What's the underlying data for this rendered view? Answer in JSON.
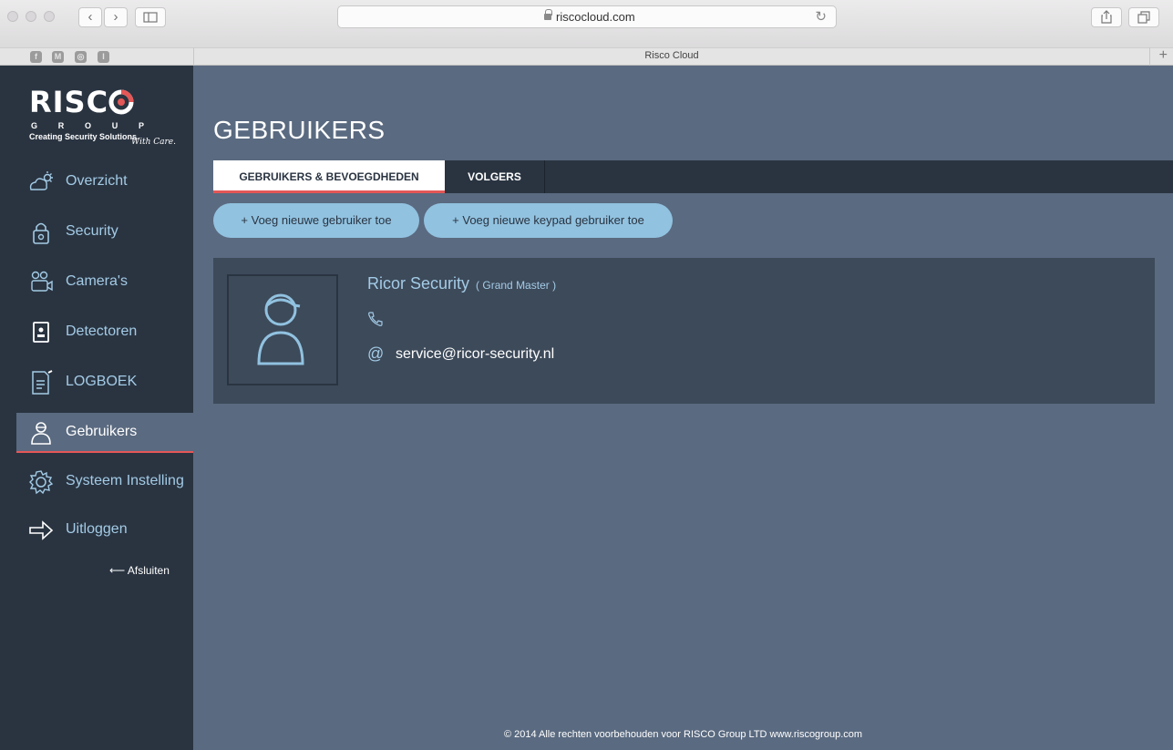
{
  "browser": {
    "url": "riscocloud.com",
    "tab_title": "Risco Cloud",
    "back": "‹",
    "forward": "›",
    "reload": "↻",
    "favorites": [
      "f",
      "M",
      "◎",
      "I"
    ]
  },
  "sidebar": {
    "logo": {
      "word": "RISCO",
      "group_letters": [
        "G",
        "R",
        "O",
        "U",
        "P"
      ],
      "tagline": "Creating Security Solutions.",
      "tagline_script": "With Care."
    },
    "items": [
      {
        "label": "Overzicht",
        "icon": "cloud-sun-icon"
      },
      {
        "label": "Security",
        "icon": "padlock-icon"
      },
      {
        "label": "Camera's",
        "icon": "camera-icon"
      },
      {
        "label": "Detectoren",
        "icon": "detector-icon"
      },
      {
        "label": "LOGBOEK",
        "icon": "log-icon"
      },
      {
        "label": "Gebruikers",
        "icon": "user-icon",
        "active": true
      },
      {
        "label": "Systeem Instelling",
        "icon": "gear-icon"
      },
      {
        "label": "Uitloggen",
        "icon": "logout-arrow-icon"
      }
    ],
    "close_label": "⟵ Afsluiten"
  },
  "main": {
    "title": "GEBRUIKERS",
    "tabs": [
      {
        "label": "GEBRUIKERS & BEVOEGDHEDEN",
        "active": true
      },
      {
        "label": "VOLGERS",
        "active": false
      }
    ],
    "buttons": {
      "add_user": "+ Voeg nieuwe gebruiker toe",
      "add_keypad_user": "+ Voeg nieuwe keypad gebruiker toe"
    },
    "user": {
      "name": "Ricor Security",
      "role": "( Grand Master )",
      "email": "service@ricor-security.nl",
      "at_symbol": "@"
    },
    "footer": "© 2014 Alle rechten voorbehouden voor RISCO Group LTD  www.riscogroup.com"
  },
  "colors": {
    "sidebar_bg": "#2a3441",
    "main_bg": "#5a6a80",
    "card_bg": "#3d4a5a",
    "accent_blue": "#a3cbe6",
    "button_bg": "#91c2e0",
    "accent_red": "#e45757"
  }
}
